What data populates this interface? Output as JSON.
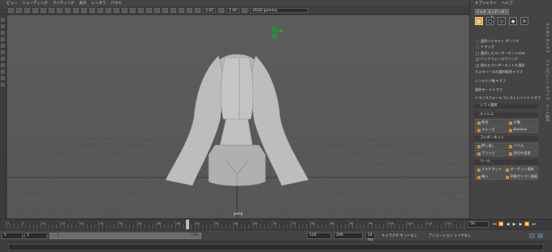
{
  "menubar": {
    "items": [
      "ビュー",
      "シェーディング",
      "ライティング",
      "表示",
      "レンダラ",
      "パネル"
    ]
  },
  "viewport_toolbar": {
    "value1": "0.00",
    "value2": "1.00",
    "colorspace": "sRGB gamma"
  },
  "viewport": {
    "camera_label": "persp"
  },
  "right_panel": {
    "tabs": [
      "オブジェクト",
      "ヘルプ"
    ],
    "mode_button": "マルチ コンポーネント",
    "options": [
      {
        "type": "radio",
        "label": "選択ハイライト ボックス"
      },
      {
        "type": "radio",
        "label": "ドラッグ"
      },
      {
        "type": "check",
        "label": "選択したコンポーネントのみ"
      },
      {
        "type": "check",
        "label": "バックフェースカリング"
      },
      {
        "type": "check",
        "label": "隠れたコンポーネントを選択"
      }
    ],
    "rows": [
      {
        "label": "カメラベースの選択範囲",
        "value": "オフ"
      },
      {
        "label": "シンメトリ軸",
        "value": "オフ"
      },
      {
        "label": "選択モード",
        "value": "オフ"
      },
      {
        "label": "トランスフォーム コンストレイント",
        "value": "オフ"
      }
    ],
    "sections": {
      "soft": "ソフト選択",
      "mesh": "メッシュ",
      "component": "コンポーネント",
      "tool": "ツール"
    },
    "mesh_buttons": [
      "結合",
      "分離",
      "スムーズ",
      "Boolean"
    ],
    "component_buttons": [
      "押し出し",
      "ベベル",
      "ブリッジ",
      "頂点を追加"
    ],
    "tool_buttons": [
      "マルチカット",
      "ターゲット連結",
      "挿入",
      "四角ポリゴン描画"
    ],
    "vertical_tabs": [
      "チャネル ボックス",
      "アトリビュート エディタ",
      "ツール設定"
    ]
  },
  "timeline": {
    "ticks": [
      "1",
      "5",
      "10",
      "15",
      "20",
      "25",
      "30",
      "35",
      "40",
      "45",
      "50",
      "55",
      "60",
      "65",
      "70",
      "75",
      "80",
      "85",
      "90",
      "95",
      "100",
      "105",
      "110",
      "115",
      "120"
    ],
    "current_frame_label": "50",
    "end_field": "50"
  },
  "range": {
    "start": "1",
    "start2": "1",
    "slider_start": "1",
    "slider_end": "120",
    "end": "120",
    "max": "200",
    "fps": "24 fps",
    "char_label": "キャラクタ セットなし",
    "anim_label": "アニメーション レイヤなし"
  },
  "colors": {
    "accent": "#e7a23b",
    "bg": "#444444",
    "viewport": "#5a5a5a",
    "mesh": "#b5b5b5"
  }
}
